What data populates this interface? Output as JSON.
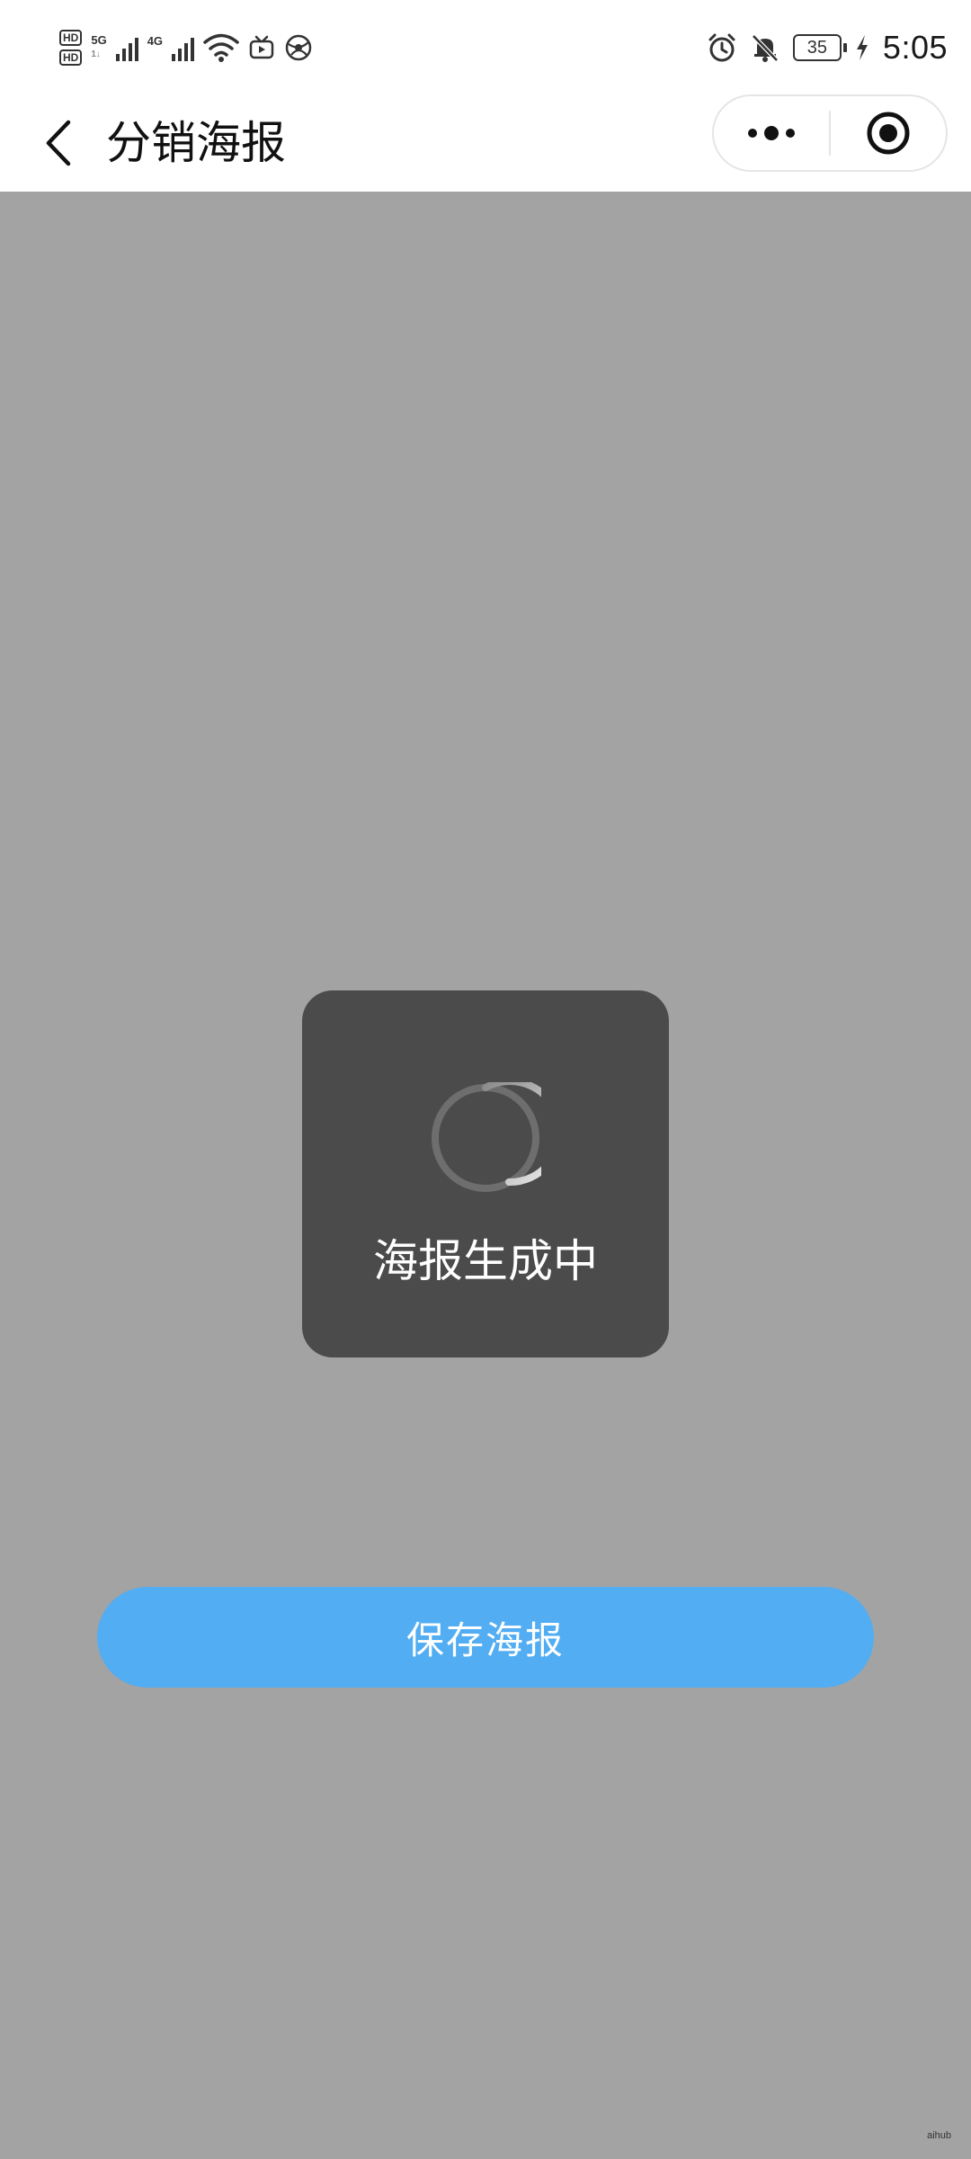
{
  "status_bar": {
    "hd_label": "HD",
    "net_5g": "5G",
    "net_4g": "4G",
    "battery_level": "35",
    "time": "5:05",
    "icons": [
      "hd-icon",
      "signal-icon",
      "wifi-icon",
      "tv-icon",
      "globe-icon",
      "alarm-icon",
      "mute-bell-icon",
      "battery-icon",
      "charging-icon"
    ]
  },
  "nav": {
    "title": "分销海报",
    "back_icon": "chevron-left-icon",
    "more_icon": "more-dots-icon",
    "close_icon": "target-circle-icon"
  },
  "toast": {
    "text": "海报生成中",
    "spinner_icon": "loading-spinner-icon"
  },
  "actions": {
    "save_label": "保存海报"
  },
  "colors": {
    "overlay_bg": "#a3a3a3",
    "toast_bg": "#4b4b4b",
    "button_bg": "#52adf2",
    "header_bg": "#ffffff"
  }
}
